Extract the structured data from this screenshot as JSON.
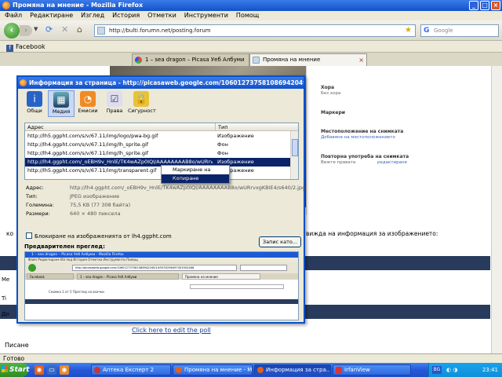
{
  "window": {
    "title": "Промяна на мнение - Mozilla Firefox",
    "buttons": [
      "_",
      "□",
      "×"
    ]
  },
  "menu": [
    "Файл",
    "Редактиране",
    "Изглед",
    "История",
    "Отметки",
    "Инструменти",
    "Помощ"
  ],
  "nav": {
    "url": "http://bulti.forumn.net/posting.forum",
    "search_placeholder": "Google",
    "icons": [
      "back-icon",
      "forward-icon",
      "reload-icon",
      "stop-icon",
      "home-icon",
      "star-icon"
    ]
  },
  "bookmarks": [
    {
      "label": "Facebook",
      "icon": "facebook-icon"
    }
  ],
  "tabs": [
    {
      "label": "1 – sea dragon – Picasa Уеб Албуми",
      "active": false
    },
    {
      "label": "Промяна на мнение",
      "active": true
    }
  ],
  "page": {
    "right_panel": {
      "fav_text": "Хора",
      "fav_sub": "Без хора",
      "tags_label": "Маркери",
      "location_label": "Местоположение на снимката",
      "location_link": "Добавяне на местоположението",
      "views_label": "Повторна употреба на снимката",
      "views_link": "Вижте правата",
      "edit_link": "редактиране"
    },
    "truncated_left": "ко",
    "info_text": "вижда на информация за изображението:",
    "edit_poll": "Click here to edit the poll",
    "pisane": "Писане",
    "side_labels": [
      "Me",
      "Ti",
      "До"
    ]
  },
  "status": "Готово",
  "dialog": {
    "title": "Информация за страница - http://picasaweb.google.com/106012737581086942049/1#53",
    "tabs": [
      {
        "label": "Общи",
        "icon": "info-icon"
      },
      {
        "label": "Медия",
        "icon": "media-icon"
      },
      {
        "label": "Емисии",
        "icon": "feed-icon"
      },
      {
        "label": "Права",
        "icon": "permissions-icon"
      },
      {
        "label": "Сигурност",
        "icon": "lock-icon"
      }
    ],
    "list": {
      "col_address": "Адрес",
      "col_type": "Тип",
      "rows": [
        {
          "address": "http://lh5.ggpht.com/s/v/67.11/img/logo/pwa-bg.gif",
          "type": "Изображение"
        },
        {
          "address": "http://lh4.ggpht.com/s/v/67.11/img/lh_sprite.gif",
          "type": "Фон"
        },
        {
          "address": "http://lh4.ggpht.com/s/v/67.11/img/lh_sprite.gif",
          "type": "Фон"
        },
        {
          "address": "http://lh4.ggpht.com/_oEBH9v_HnlE/TK4wAZp0IQI/AAAAAAAAB8o/wURrvxgKBIE4/s640/",
          "type": "Изображение",
          "selected": true
        },
        {
          "address": "http://lh5.ggpht.com/s/v/67.11/img/transparent.gif",
          "type": "Изображение"
        }
      ]
    },
    "context_menu": [
      "Маркиране на всичко",
      "Копиране"
    ],
    "props": [
      {
        "label": "Адрес:",
        "value": "http://lh4.ggpht.com/_oEBH9v_HnlE/TK4wAZp0IQI/AAAAAAAAB8o/wURrvxgKBIE4/s640/2.jpg"
      },
      {
        "label": "Тип:",
        "value": "JPEG изображение"
      },
      {
        "label": "Големина:",
        "value": "75,5 KB (77 308 байта)"
      },
      {
        "label": "Размери:",
        "value": "640 × 480 пиксела"
      }
    ],
    "block_label": "Блокиране на изображенията от lh4.ggpht.com",
    "save_as": "Запис като...",
    "preview_label": "Предварителен преглед:",
    "preview": {
      "title": "1 – sea dragon – Picasa Уеб Албуми - Mozilla Firefox",
      "menu": "Файл  Редактиране  Изглед  История  Отметки  Инструменти  Помощ",
      "url": "http://picasaweb.google.com/106012737581086942049/1#5535296497453302466",
      "tab1": "Facebook",
      "tab2": "1 – sea dragon – Picasa Уеб Албуми",
      "tab3": "Промяна на мнение",
      "content_text": "Снимка 1 от 5   Прeглед на всички"
    }
  },
  "taskbar": {
    "start": "Start",
    "tasks": [
      {
        "label": "Аптека Експерт 2",
        "active": false
      },
      {
        "label": "Промяна на мнение - M...",
        "active": false
      },
      {
        "label": "Информация за стра...",
        "active": true
      },
      {
        "label": "IrfanView",
        "active": false
      }
    ],
    "lang": "BG",
    "clock": "23:41"
  }
}
